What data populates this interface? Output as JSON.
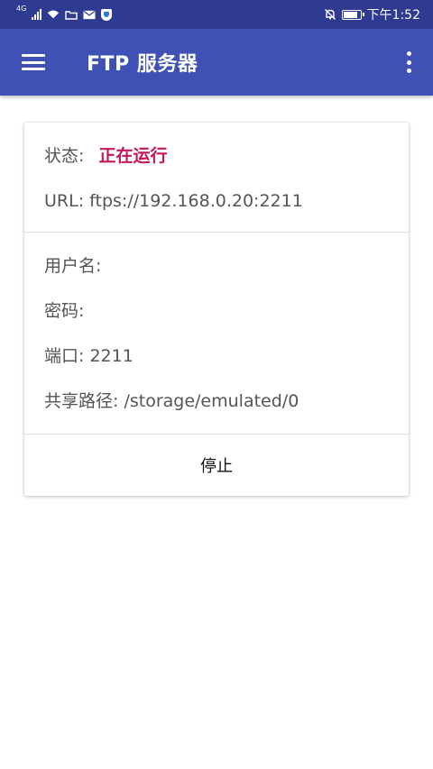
{
  "statusbar": {
    "network": "4G",
    "time": "下午1:52",
    "battery_level": 0.85
  },
  "appbar": {
    "title": "FTP 服务器"
  },
  "card": {
    "status_label": "状态:",
    "status_value": "正在运行",
    "url_label": "URL:",
    "url_value": "ftps://192.168.0.20:2211",
    "username_label": "用户名:",
    "username_value": "",
    "password_label": "密码:",
    "password_value": "",
    "port_label": "端口:",
    "port_value": "2211",
    "path_label": "共享路径:",
    "path_value": "/storage/emulated/0",
    "stop_label": "停止"
  },
  "colors": {
    "statusbar": "#2f3b91",
    "appbar": "#3f51b5",
    "status_running": "#c2185b"
  }
}
